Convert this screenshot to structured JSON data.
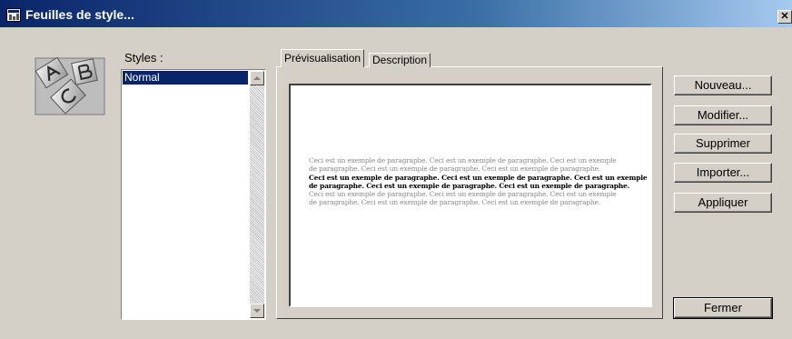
{
  "window": {
    "title": "Feuilles de style...",
    "close_glyph": "✕"
  },
  "icons": {
    "window_icon": "spreadsheet-icon",
    "app_icon": "style-sheets-icon",
    "close": "close-icon"
  },
  "styles_panel": {
    "label": "Styles :",
    "items": [
      "Normal"
    ],
    "selected": "Normal"
  },
  "tabs": [
    {
      "label": "Prévisualisation",
      "active": true
    },
    {
      "label": "Description",
      "active": false
    }
  ],
  "preview": {
    "lines": [
      {
        "text": "Ceci est un exemple de paragraphe. Ceci est un exemple de paragraphe. Ceci est un exemple",
        "style": "grey"
      },
      {
        "text": "de paragraphe. Ceci est un exemple de paragraphe. Ceci est un exemple de paragraphe.",
        "style": "grey"
      },
      {
        "text": "Ceci est un exemple de paragraphe. Ceci est un exemple de paragraphe. Ceci est un exemple",
        "style": "bold"
      },
      {
        "text": "de paragraphe. Ceci est un exemple de paragraphe. Ceci est un exemple de paragraphe.",
        "style": "bold"
      },
      {
        "text": "Ceci est un exemple de paragraphe. Ceci est un exemple de paragraphe. Ceci est un exemple",
        "style": "grey"
      },
      {
        "text": "de paragraphe. Ceci est un exemple de paragraphe. Ceci est un exemple de paragraphe.",
        "style": "grey"
      }
    ]
  },
  "buttons": {
    "new": "Nouveau...",
    "modify": "Modifier...",
    "delete": "Supprimer",
    "import": "Importer...",
    "apply": "Appliquer",
    "close": "Fermer"
  },
  "colors": {
    "title_gradient_start": "#0a246a",
    "title_gradient_end": "#a6caf0",
    "selection": "#0a246a",
    "face": "#d4d0c8"
  }
}
